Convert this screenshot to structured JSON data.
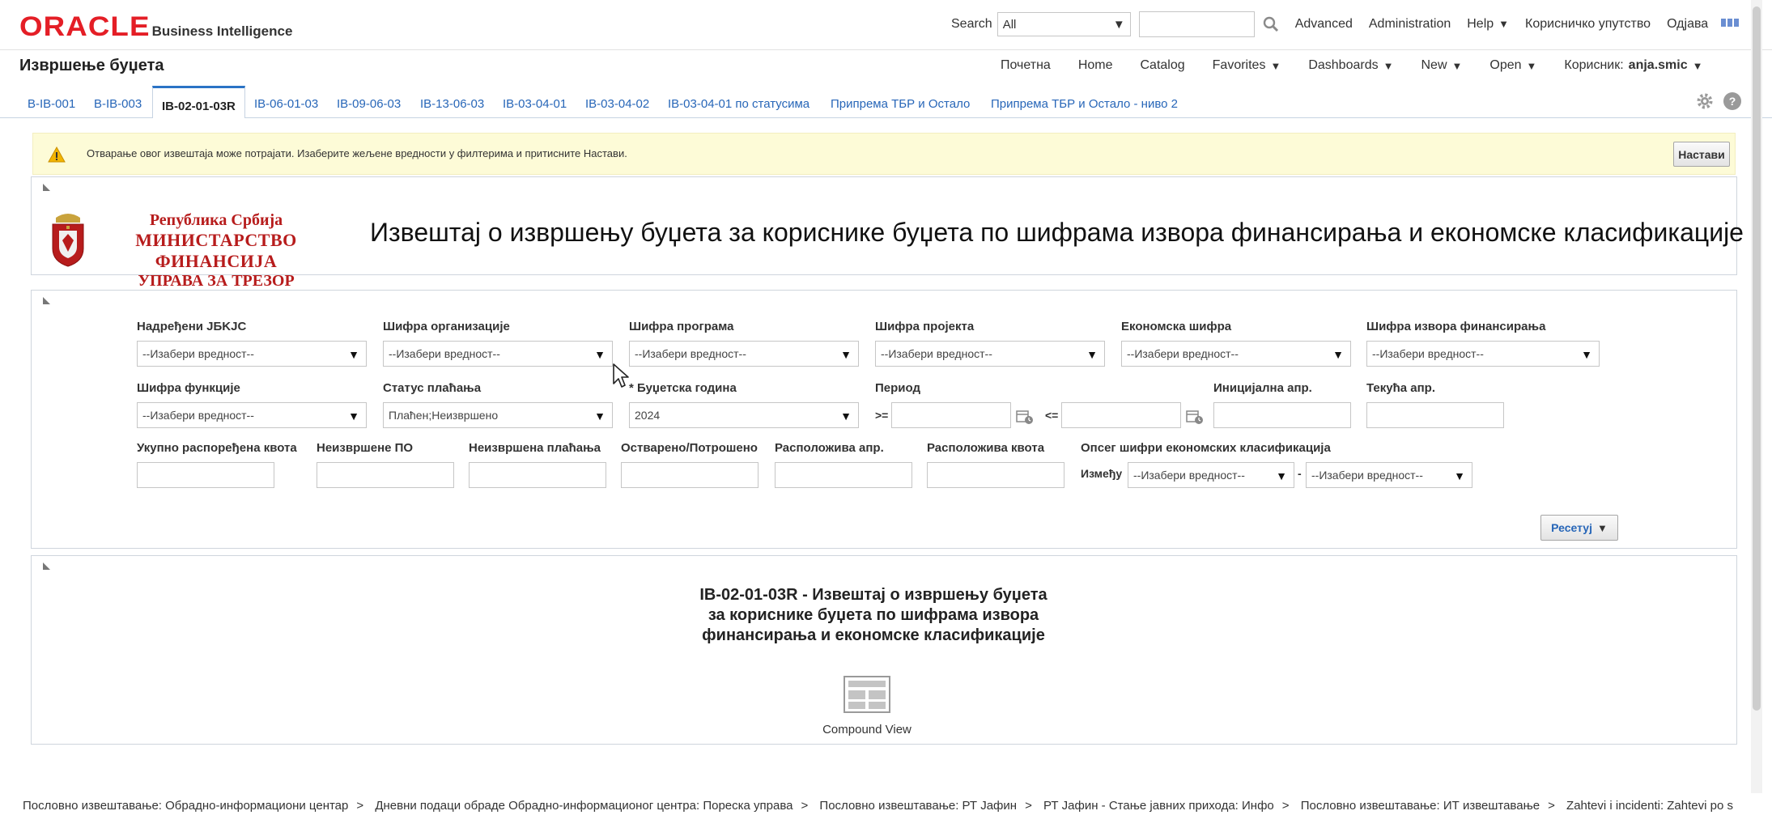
{
  "app": {
    "logo_text": "ORACLE",
    "product_name": "Business Intelligence"
  },
  "header": {
    "search_label": "Search",
    "search_scope": "All",
    "search_value": "",
    "links": [
      "Advanced",
      "Administration",
      "Help",
      "Корисничко упутство",
      "Одјава"
    ]
  },
  "titlebar": {
    "page_title": "Извршење буџета",
    "nav": [
      "Почетна",
      "Home",
      "Catalog",
      "Favorites",
      "Dashboards",
      "New",
      "Open"
    ],
    "user_label": "Корисник:",
    "user_name": "anja.smic"
  },
  "tabs": [
    {
      "label": "B-IB-001",
      "active": false
    },
    {
      "label": "B-IB-003",
      "active": false
    },
    {
      "label": "IB-02-01-03R",
      "active": true
    },
    {
      "label": "IB-06-01-03",
      "active": false
    },
    {
      "label": "IB-09-06-03",
      "active": false
    },
    {
      "label": "IB-13-06-03",
      "active": false
    },
    {
      "label": "IB-03-04-01",
      "active": false
    },
    {
      "label": "IB-03-04-02",
      "active": false
    },
    {
      "label": "IB-03-04-01 по статусима",
      "active": false
    },
    {
      "label": "Припрема ТБР и Остало",
      "active": false
    },
    {
      "label": "Припрема ТБР и Остало - ниво 2",
      "active": false
    }
  ],
  "warning": {
    "text": "Отварање овог извештаја може потрајати. Изаберите жељене вредности у филтерима и притисните Настави.",
    "continue_label": "Настави"
  },
  "banner": {
    "line1": "Република Србија",
    "line2": "МИНИСТАРСТВО ФИНАНСИЈА",
    "line3": "УПРАВА ЗА ТРЕЗОР",
    "report_heading": "Извештај о извршењу буџета за кориснике буџета по шифрама извора финансирања и економске класификације"
  },
  "filters": {
    "superior_jbkjc": {
      "label": "Надређени JБKJC",
      "value": "--Изабери вредност--"
    },
    "org_code": {
      "label": "Шифра организације",
      "value": "--Изабери вредност--"
    },
    "program_code": {
      "label": "Шифра програма",
      "value": "--Изабери вредност--"
    },
    "project_code": {
      "label": "Шифра пројекта",
      "value": "--Изабери вредност--"
    },
    "economic_code": {
      "label": "Економска шифра",
      "value": "--Изабери вредност--"
    },
    "funding_source_code": {
      "label": "Шифра извора финансирања",
      "value": "--Изабери вредност--"
    },
    "function_code": {
      "label": "Шифра функције",
      "value": "--Изабери вредност--"
    },
    "payment_status": {
      "label": "Статус плаћања",
      "value": "Плаћен;Неизвршено"
    },
    "budget_year": {
      "label": "* Буџетска година",
      "value": "2024"
    },
    "period": {
      "label": "Период",
      "op_from": ">=",
      "op_to": "<=",
      "from": "",
      "to": ""
    },
    "initial_appr": {
      "label": "Иницијална апр.",
      "value": ""
    },
    "current_appr": {
      "label": "Текућа апр.",
      "value": ""
    },
    "total_quota": {
      "label": "Укупно распоређена квота",
      "value": ""
    },
    "unexecuted_po": {
      "label": "Неизвршене ПО",
      "value": ""
    },
    "unexecuted_payments": {
      "label": "Неизвршена плаћања",
      "value": ""
    },
    "realized_spent": {
      "label": "Остварено/Потрошено",
      "value": ""
    },
    "available_appr": {
      "label": "Расположива апр.",
      "value": ""
    },
    "available_quota": {
      "label": "Расположива квота",
      "value": ""
    },
    "econ_range": {
      "label": "Опсег шифри економских класификација",
      "between_label": "Између",
      "from": "--Изабери вредност--",
      "dash": "-",
      "to": "--Изабери вредност--"
    },
    "reset_label": "Ресетуј"
  },
  "compound_view": {
    "title": "IB-02-01-03R - Извештај о извршењу буџета за кориснике буџета по шифрама извора финансирања и економске класификације",
    "label": "Compound View"
  },
  "breadcrumbs": [
    "Пословно извештавање: Обрадно-информациони центар",
    "Дневни подаци обраде Обрадно-информационог центра: Пореска управа",
    "Пословно извештавање: РТ Јафин",
    "РТ Јафин - Стање јавних прихода: Инфо",
    "Пословно извештавање: ИТ извештавање",
    "Zahtevi i incidenti: Zahtevi po s"
  ],
  "icons": {
    "search": "magnifier-icon",
    "apps": "grid-icon",
    "settings": "gear-icon",
    "help": "help-icon",
    "warning": "warning-icon",
    "calendar": "calendar-icon",
    "compound_view": "compound-view-icon"
  },
  "colors": {
    "brand": "#e41e26",
    "link": "#2766b8",
    "warning_bg": "#fdfbd7",
    "ministry": "#b71c1c"
  }
}
